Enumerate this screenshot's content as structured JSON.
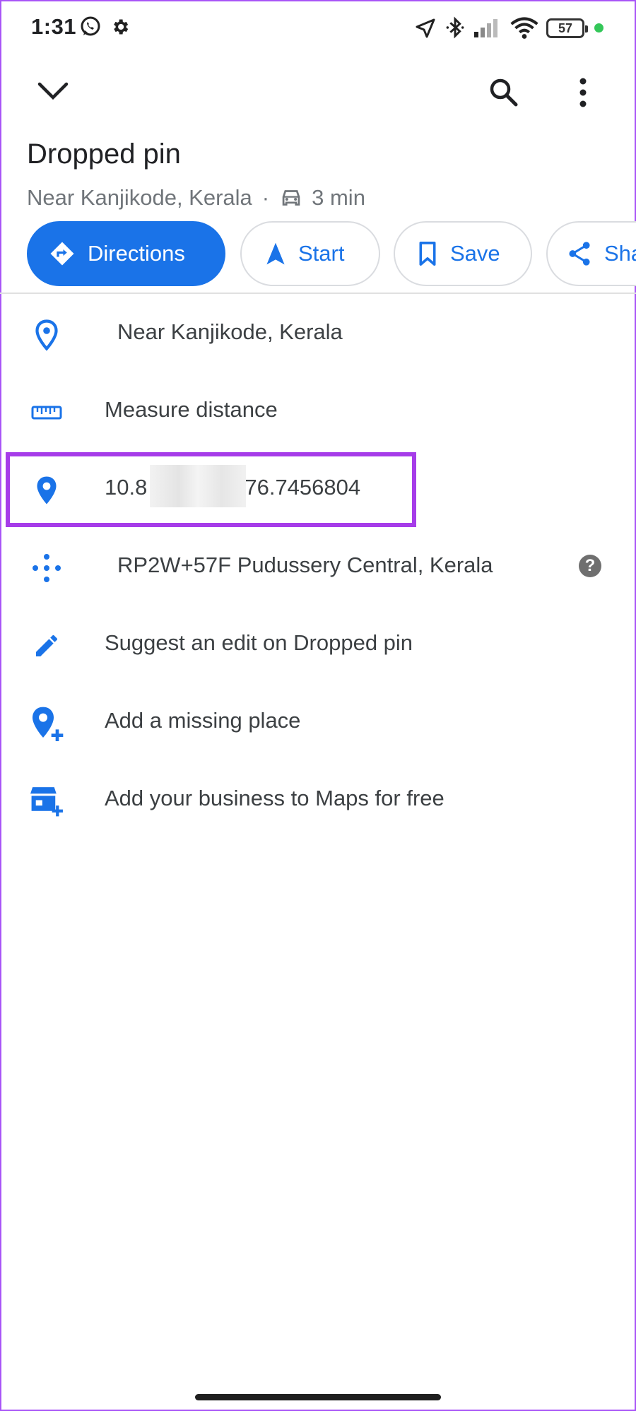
{
  "status_bar": {
    "time": "1:31",
    "battery": "57"
  },
  "header": {
    "title": "Dropped pin",
    "subtitle_location": "Near Kanjikode, Kerala",
    "subtitle_separator": "·",
    "drive_time": "3 min"
  },
  "actions": {
    "directions": "Directions",
    "start": "Start",
    "save": "Save",
    "share": "Share"
  },
  "list": {
    "address": "Near Kanjikode, Kerala",
    "measure": "Measure distance",
    "coords_prefix": "10.8",
    "coords_suffix": "76.7456804",
    "plus_code": "RP2W+57F Pudussery Central, Kerala",
    "suggest_edit": "Suggest an edit on Dropped pin",
    "add_place": "Add a missing place",
    "add_business": "Add your business to Maps for free",
    "help_glyph": "?"
  },
  "colors": {
    "accent": "#1a73e8",
    "highlight": "#a63ce9",
    "frame": "#a855f7"
  }
}
